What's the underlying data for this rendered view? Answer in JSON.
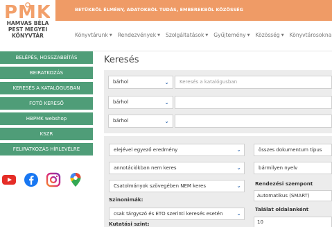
{
  "brand": {
    "logo_mark": "PMK",
    "name_lines": [
      "HAMVAS BÉLA",
      "PEST MEGYEI",
      "KÖNYVTÁR"
    ],
    "tagline": "BETŰKBŐL ÉLMÉNY, ADATOKBÓL TUDÁS, EMBEREKBŐL KÖZÖSSÉG"
  },
  "nav": {
    "items": [
      "Könyvtárunk",
      "Rendezvények",
      "Szolgáltatások",
      "Gyűjtemény",
      "Közösség",
      "Könyvtárosoknak"
    ]
  },
  "sidebar": {
    "items": [
      "BELÉPÉS, HOSSZABBÍTÁS",
      "BEIRATKOZÁS",
      "KERESÉS A KATALÓGUSBAN",
      "FOTÓ KERESŐ",
      "HBPMK webshop",
      "KSZR",
      "FELIRATKOZÁS HÍRLEVÉLRE"
    ],
    "socials": [
      "youtube-icon",
      "facebook-icon",
      "instagram-icon",
      "google-maps-icon"
    ]
  },
  "main": {
    "title": "Keresés",
    "search_rows": [
      {
        "field": "bárhol",
        "placeholder": "Keresés a katalógusban"
      },
      {
        "field": "bárhol",
        "placeholder": ""
      },
      {
        "field": "bárhol",
        "placeholder": ""
      }
    ],
    "options": {
      "match": "elejével egyező eredmény",
      "annotations": "annotációkban nem keres",
      "attachments": "Csatolmányok szövegében NEM keres",
      "synonyms_label": "Szinonimák:",
      "synonyms": "csak tárgyszó és ETO szerinti keresés esetén",
      "level_label": "Kutatási szint:",
      "doc_type": "összes dokumentum típus",
      "language": "bármilyen nyelv",
      "sort_label": "Rendezési szempont",
      "sort_value": "Automatikus (SMART)",
      "per_page_label": "Találat oldalanként",
      "per_page_value": "10"
    }
  },
  "colors": {
    "accent_orange": "#ef9b66",
    "sidebar_green": "#4f9d78",
    "panel_gray": "#ececec",
    "chevron_blue": "#1e5aa8"
  }
}
